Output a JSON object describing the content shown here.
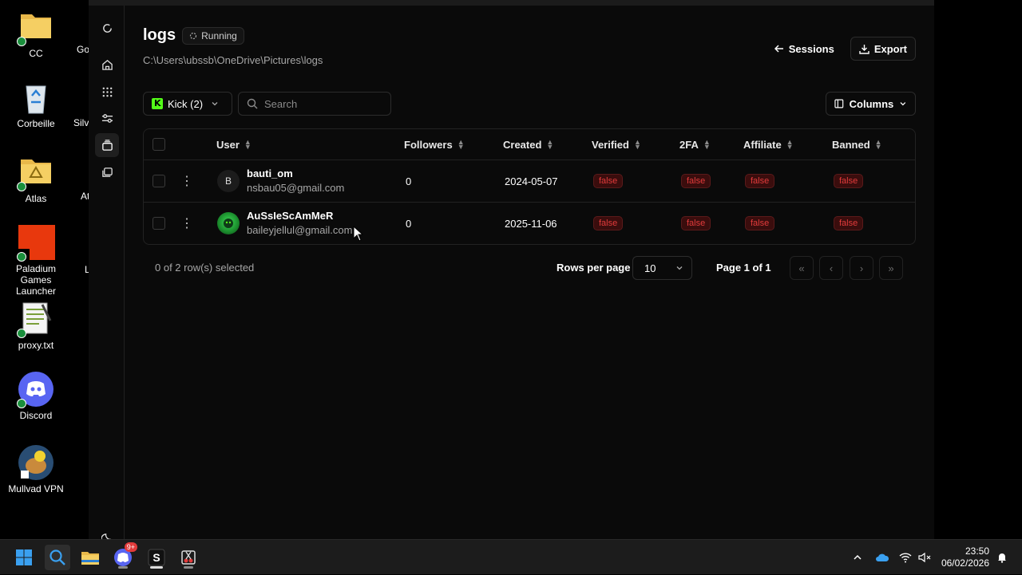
{
  "desktop": {
    "icons": [
      {
        "label": "CC"
      },
      {
        "label": "Corbeille"
      },
      {
        "label": "Atlas"
      },
      {
        "label": "Paladium Games Launcher"
      },
      {
        "label": "proxy.txt"
      },
      {
        "label": "Discord"
      },
      {
        "label": "Mullvad VPN"
      }
    ],
    "partials": [
      "Go",
      "Silv",
      "At",
      "L"
    ]
  },
  "app": {
    "title": "logs",
    "status": "Running",
    "path": "C:\\Users\\ubssb\\OneDrive\\Pictures\\logs",
    "sessions_label": "Sessions",
    "export_label": "Export",
    "platform_select": "Kick (2)",
    "search_placeholder": "Search",
    "columns_label": "Columns",
    "table": {
      "headers": {
        "user": "User",
        "followers": "Followers",
        "created": "Created",
        "verified": "Verified",
        "twofa": "2FA",
        "affiliate": "Affiliate",
        "banned": "Banned"
      },
      "rows": [
        {
          "avatar": "B",
          "username": "bauti_om",
          "email": "nsbau05@gmail.com",
          "followers": "0",
          "created": "2024-05-07",
          "verified": "false",
          "twofa": "false",
          "affiliate": "false",
          "banned": "false"
        },
        {
          "avatar": "",
          "username": "AuSsIeScAmMeR",
          "email": "baileyjellul@gmail.com",
          "followers": "0",
          "created": "2025-11-06",
          "verified": "false",
          "twofa": "false",
          "affiliate": "false",
          "banned": "false"
        }
      ]
    },
    "footer": {
      "selected": "0 of 2 row(s) selected",
      "rows_per_page_label": "Rows per page",
      "rows_per_page": "10",
      "page": "Page 1 of 1"
    }
  },
  "taskbar": {
    "discord_badge": "9+",
    "time": "23:50",
    "date": "06/02/2026"
  },
  "colors": {
    "accent_green": "#53fc18",
    "false_pill": "#e23b3b"
  }
}
